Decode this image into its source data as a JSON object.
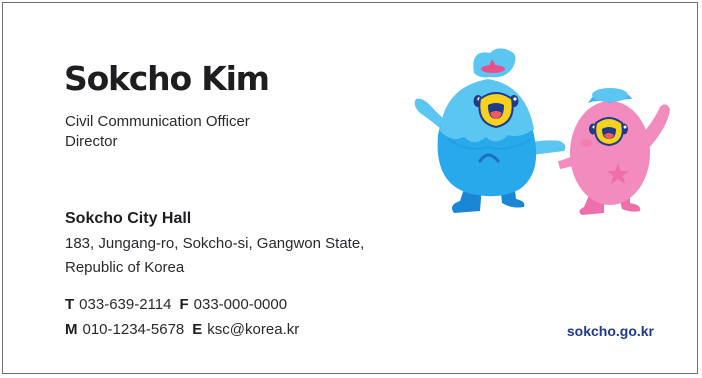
{
  "card": {
    "name": "Sokcho Kim",
    "title_lines": [
      "Civil Communication Officer",
      "Director"
    ],
    "organization": "Sokcho City Hall",
    "address_lines": [
      "183, Jungang-ro, Sokcho-si, Gangwon State,",
      "Republic of Korea"
    ],
    "contact": {
      "tel_label": "T",
      "tel": "033-639-2114",
      "fax_label": "F",
      "fax": "033-000-0000",
      "mobile_label": "M",
      "mobile": "010-1234-5678",
      "email_label": "E",
      "email": "ksc@korea.kr"
    },
    "website": "sokcho.go.kr"
  },
  "mascots": {
    "icons": [
      "blue-mascot-icon",
      "pink-mascot-icon"
    ],
    "colors": {
      "blue_body": "#27a9ec",
      "blue_head": "#5cc6f2",
      "pink_body": "#f28cbf",
      "pink_head": "#f7a8cf",
      "beak": "#f6d11d",
      "mouth": "#1f3a8a",
      "accent": "#e94f8a"
    }
  },
  "colors": {
    "text": "#1e1e22",
    "link": "#1f3a8a",
    "border": "#6e6e6e"
  }
}
